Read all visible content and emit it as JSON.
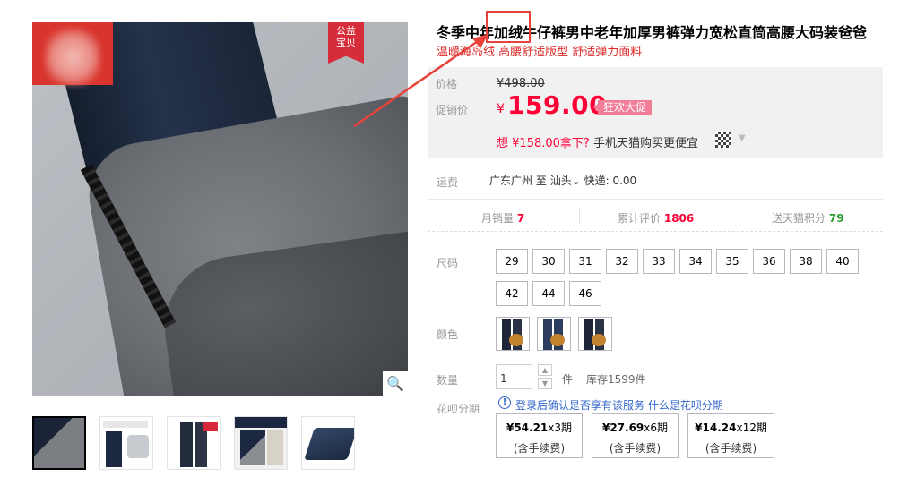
{
  "gallery": {
    "charity_badge": [
      "公益",
      "宝贝"
    ],
    "zoom_icon": "magnifier",
    "thumbnails": [
      {
        "active": true
      },
      {
        "active": false
      },
      {
        "active": false
      },
      {
        "active": false
      },
      {
        "active": false
      }
    ]
  },
  "product": {
    "title": "冬季中年加绒牛仔裤男中老年加厚男裤弹力宽松直筒高腰大码装爸爸",
    "subtitle": "温暖海岛绒 高腰舒适版型 舒适弹力面料"
  },
  "price": {
    "orig_label": "价格",
    "orig_currency": "¥",
    "orig_value": "498.00",
    "promo_label": "促销价",
    "currency": "¥",
    "value": "159.00",
    "promo_tag": "狂欢大促",
    "app_prefix": "想",
    "app_price": "¥158.00",
    "app_suffix": "拿下?",
    "app_text": "手机天猫购买更便宜"
  },
  "shipping": {
    "label": "运费",
    "from": "广东广州",
    "to_word": "至",
    "to": "汕头",
    "express": "快递: 0.00"
  },
  "stats": {
    "monthly_label": "月销量",
    "monthly_value": "7",
    "reviews_label": "累计评价",
    "reviews_value": "1806",
    "points_label": "送天猫积分",
    "points_value": "79"
  },
  "sizes": {
    "label": "尺码",
    "options": [
      "29",
      "30",
      "31",
      "32",
      "33",
      "34",
      "35",
      "36",
      "38",
      "40",
      "42",
      "44",
      "46"
    ]
  },
  "colors": {
    "label": "颜色"
  },
  "quantity": {
    "label": "数量",
    "value": "1",
    "unit": "件",
    "stock": "库存1599件"
  },
  "installment": {
    "label": "花呗分期",
    "notice": "登录后确认是否享有该服务",
    "link": "什么是花呗分期",
    "plans": [
      {
        "amount": "¥54.21",
        "periods": "x3期",
        "fee": "(含手续费)"
      },
      {
        "amount": "¥27.69",
        "periods": "x6期",
        "fee": "(含手续费)"
      },
      {
        "amount": "¥14.24",
        "periods": "x12期",
        "fee": "(含手续费)"
      }
    ]
  },
  "colors_theme": {
    "price_red": "#ff0036",
    "promo_pink": "#f27d96",
    "link_blue": "#3366cc",
    "annotation_red": "#e8423b"
  }
}
